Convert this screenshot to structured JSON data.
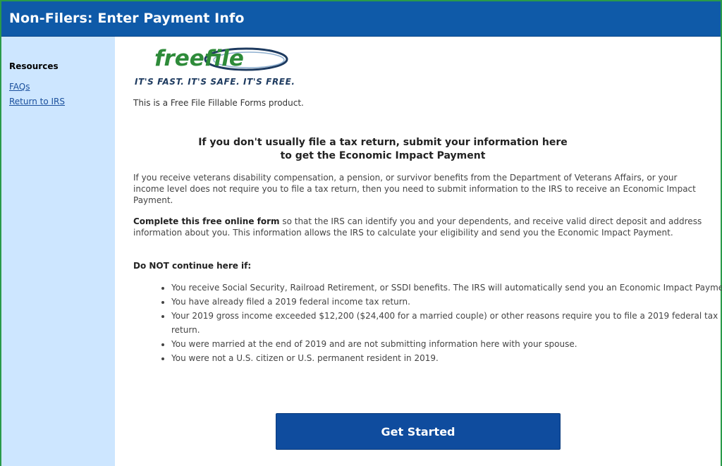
{
  "header": {
    "title": "Non-Filers: Enter Payment Info"
  },
  "sidebar": {
    "heading": "Resources",
    "links": [
      "FAQs",
      "Return to IRS"
    ]
  },
  "logo": {
    "text": "freefile",
    "icon": "freefile-swoosh-logo"
  },
  "tagline": "IT'S FAST. IT'S SAFE. IT'S FREE.",
  "product_line": "This is a Free File Fillable Forms product.",
  "headline": {
    "line1": "If you don't usually file a tax return, submit your information here",
    "line2": "to get the Economic Impact Payment"
  },
  "intro": "If you receive veterans disability compensation, a pension, or survivor benefits from the Department of Veterans Affairs, or your income level does not require you to file a tax return, then you need to submit information to the IRS to receive an Economic Impact Payment.",
  "form_note": {
    "bold": "Complete this free online form",
    "rest": " so that the IRS can identify you and your dependents, and receive valid direct deposit and address information about you. This information allows the IRS to calculate your eligibility and send you the Economic Impact Payment."
  },
  "do_not_heading": "Do NOT continue here if:",
  "do_not_items": [
    "You receive Social Security, Railroad Retirement, or SSDI benefits. The IRS will automatically send you an Economic Impact Payment.",
    "You have already filed a 2019 federal income tax return.",
    "Your 2019 gross income exceeded $12,200 ($24,400 for a married couple) or other reasons require you to file a 2019 federal tax return.",
    "You were married at the end of 2019 and are not submitting information here with your spouse.",
    "You were not a U.S. citizen or U.S. permanent resident in 2019."
  ],
  "cta": {
    "label": "Get Started"
  },
  "colors": {
    "header": "#0f5aa8",
    "sidebar": "#cde6ff",
    "button": "#0f4c9e",
    "logo_green": "#2e8b3a",
    "logo_navy": "#1d3a5f"
  }
}
